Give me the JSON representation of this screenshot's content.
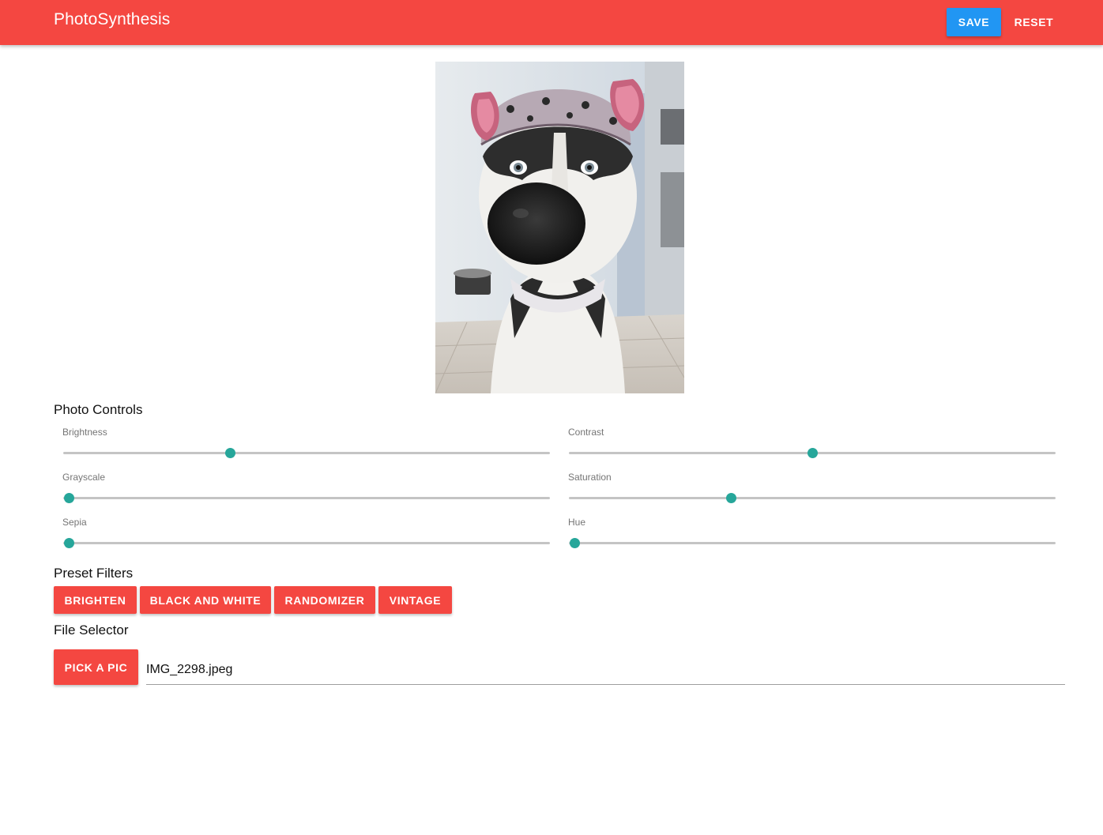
{
  "header": {
    "title": "PhotoSynthesis",
    "save_label": "SAVE",
    "reset_label": "RESET"
  },
  "photo": {
    "subject": "husky dog wearing a pink-eared hat"
  },
  "photo_controls": {
    "heading": "Photo Controls",
    "sliders": [
      {
        "id": "brightness",
        "label": "Brightness",
        "value_fraction": 0.34
      },
      {
        "id": "contrast",
        "label": "Contrast",
        "value_fraction": 0.5
      },
      {
        "id": "grayscale",
        "label": "Grayscale",
        "value_fraction": 0.0
      },
      {
        "id": "saturation",
        "label": "Saturation",
        "value_fraction": 0.33
      },
      {
        "id": "sepia",
        "label": "Sepia",
        "value_fraction": 0.0
      },
      {
        "id": "hue",
        "label": "Hue",
        "value_fraction": 0.0
      }
    ]
  },
  "preset_filters": {
    "heading": "Preset Filters",
    "buttons": [
      "BRIGHTEN",
      "BLACK AND WHITE",
      "RANDOMIZER",
      "VINTAGE"
    ]
  },
  "file_selector": {
    "heading": "File Selector",
    "button_label": "PICK A PIC",
    "file_name": "IMG_2298.jpeg"
  },
  "colors": {
    "primary": "#f44741",
    "save": "#2196f3",
    "slider_thumb": "#26a69a",
    "slider_track": "#c4c4c4"
  }
}
